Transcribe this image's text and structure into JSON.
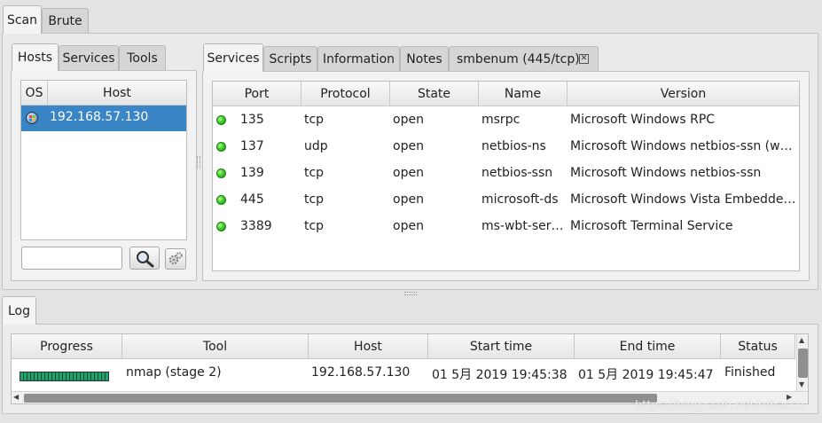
{
  "top_tabs": [
    {
      "label": "Scan"
    },
    {
      "label": "Brute"
    }
  ],
  "left_tabs": [
    {
      "label": "Hosts"
    },
    {
      "label": "Services"
    },
    {
      "label": "Tools"
    }
  ],
  "hosts_table": {
    "headers": {
      "os": "OS",
      "host": "Host"
    },
    "rows": [
      {
        "host": "192.168.57.130"
      }
    ]
  },
  "right_tabs": [
    {
      "label": "Services"
    },
    {
      "label": "Scripts"
    },
    {
      "label": "Information"
    },
    {
      "label": "Notes"
    },
    {
      "label": "smbenum (445/tcp)"
    }
  ],
  "services_table": {
    "headers": {
      "port": "Port",
      "protocol": "Protocol",
      "state": "State",
      "name": "Name",
      "version": "Version"
    },
    "rows": [
      {
        "port": "135",
        "protocol": "tcp",
        "state": "open",
        "name": "msrpc",
        "version": "Microsoft Windows RPC"
      },
      {
        "port": "137",
        "protocol": "udp",
        "state": "open",
        "name": "netbios-ns",
        "version": "Microsoft Windows netbios-ssn (wor…"
      },
      {
        "port": "139",
        "protocol": "tcp",
        "state": "open",
        "name": "netbios-ssn",
        "version": "Microsoft Windows netbios-ssn"
      },
      {
        "port": "445",
        "protocol": "tcp",
        "state": "open",
        "name": "microsoft-ds",
        "version": "Microsoft Windows Vista Embedded …"
      },
      {
        "port": "3389",
        "protocol": "tcp",
        "state": "open",
        "name": "ms-wbt-ser…",
        "version": "Microsoft Terminal Service"
      }
    ]
  },
  "log_tab": {
    "label": "Log"
  },
  "log_table": {
    "headers": {
      "progress": "Progress",
      "tool": "Tool",
      "host": "Host",
      "start": "Start time",
      "end": "End time",
      "status": "Status"
    },
    "rows": [
      {
        "progress": 1.0,
        "tool": "nmap (stage 2)",
        "host": "192.168.57.130",
        "start": "01 5月 2019 19:45:38",
        "end": "01 5月 2019 19:45:47",
        "status": "Finished"
      }
    ]
  },
  "watermark": "https://blog.csdn.net/robacco",
  "colors": {
    "selection": "#3a85c6",
    "status_dot": "#3fcf2a"
  }
}
